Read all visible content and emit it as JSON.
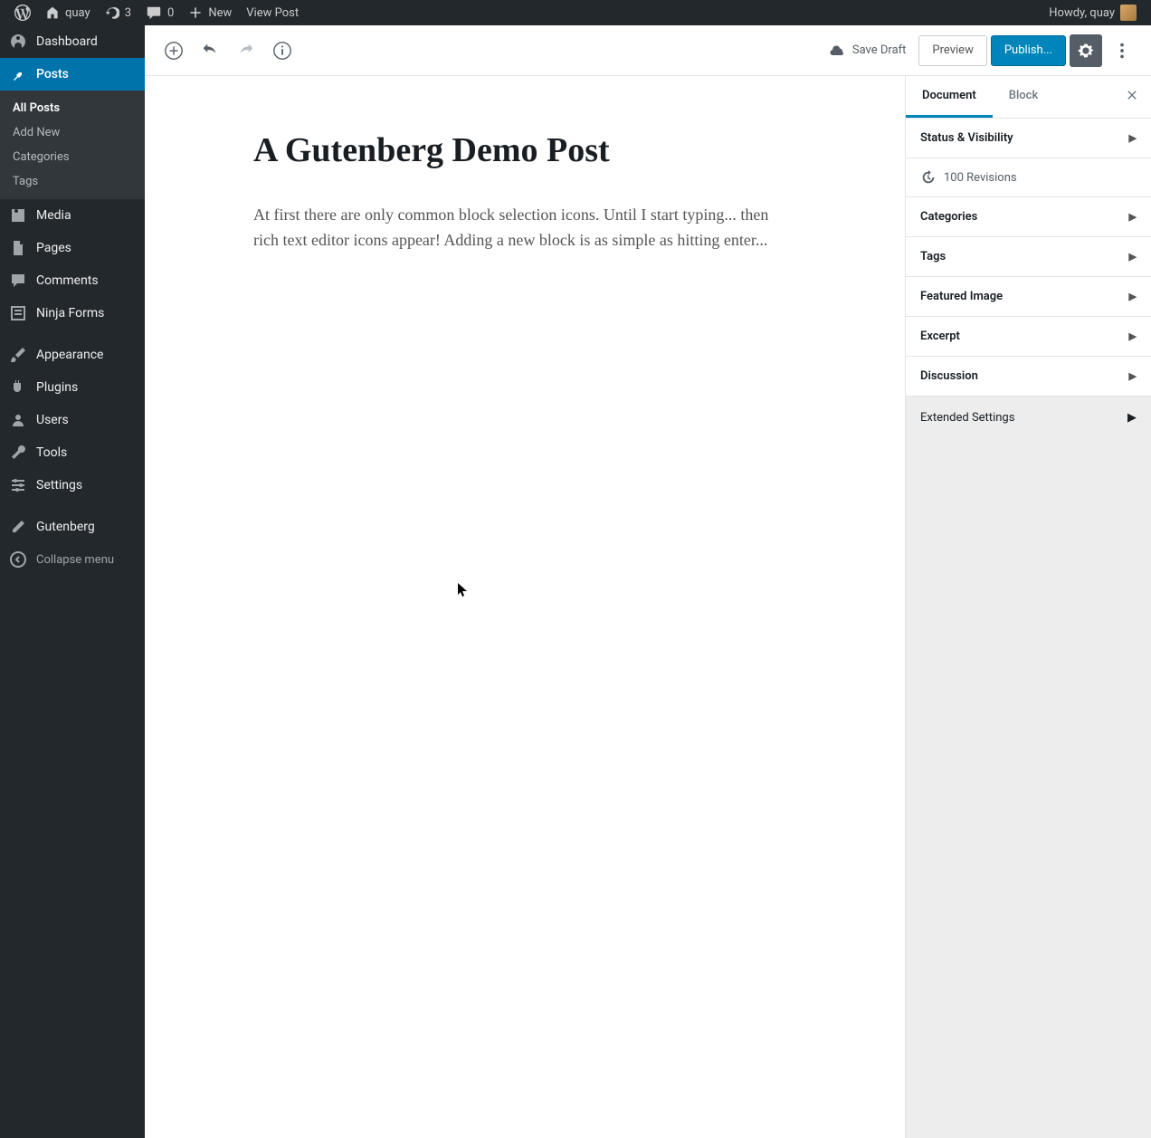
{
  "adminbar": {
    "site": "quay",
    "updates": "3",
    "comments": "0",
    "new_label": "New",
    "view_post": "View Post",
    "howdy": "Howdy, quay"
  },
  "sidebar": {
    "dashboard": "Dashboard",
    "posts": "Posts",
    "posts_sub": {
      "all": "All Posts",
      "add": "Add New",
      "categories": "Categories",
      "tags": "Tags"
    },
    "media": "Media",
    "pages": "Pages",
    "comments": "Comments",
    "ninja": "Ninja Forms",
    "appearance": "Appearance",
    "plugins": "Plugins",
    "users": "Users",
    "tools": "Tools",
    "settings": "Settings",
    "gutenberg": "Gutenberg",
    "collapse": "Collapse menu"
  },
  "topbar": {
    "save_draft": "Save Draft",
    "preview": "Preview",
    "publish": "Publish..."
  },
  "post": {
    "title": "A Gutenberg Demo Post",
    "paragraph": "At first there are only common block selection icons. Until I start typing... then rich text editor icons appear! Adding a new block is as simple as hitting enter..."
  },
  "inspector": {
    "tab_document": "Document",
    "tab_block": "Block",
    "status_visibility": "Status & Visibility",
    "revisions": "100 Revisions",
    "categories": "Categories",
    "tags": "Tags",
    "featured_image": "Featured Image",
    "excerpt": "Excerpt",
    "discussion": "Discussion",
    "extended": "Extended Settings"
  }
}
